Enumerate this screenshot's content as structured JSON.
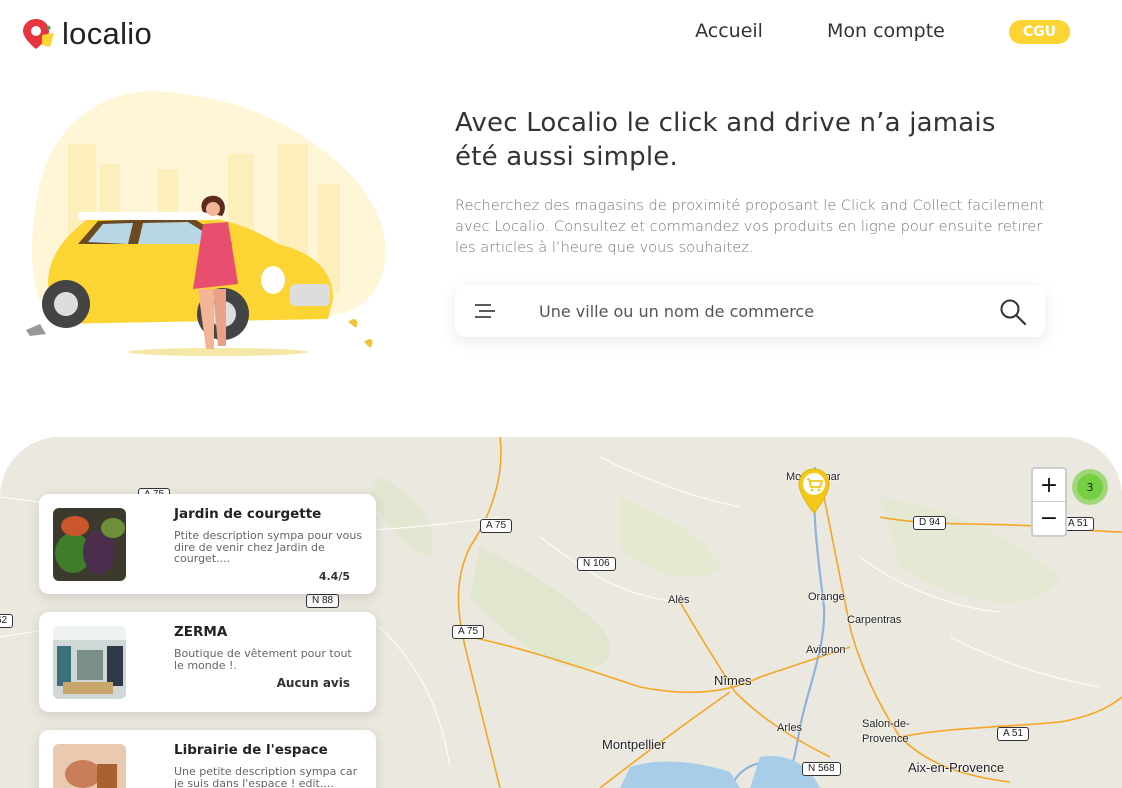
{
  "header": {
    "logo_text": "localio",
    "nav": [
      "Accueil",
      "Mon compte",
      "CGU"
    ]
  },
  "hero": {
    "title_line1": "Avec Localio le click and drive n’a jamais",
    "title_line2": "été aussi simple.",
    "description": "Recherchez des magasins de proximité proposant le Click and Collect facilement avec Localio. Consultez et commandez vos produits en ligne pour ensuite retirer les articles à l’heure que vous souhaitez.",
    "search_placeholder": "Une ville ou un nom de commerce"
  },
  "map": {
    "zoom_in": "+",
    "zoom_out": "−",
    "cluster_count": "3",
    "road_labels": [
      "A 75",
      "A 75",
      "N 106",
      "N 88",
      "D 94",
      "A 51",
      "A 51",
      "N 568",
      "62"
    ],
    "cities": [
      "Montélimar",
      "Alès",
      "Orange",
      "Carpentras",
      "Avignon",
      "Nîmes",
      "Arles",
      "Salon-de-Provence",
      "Montpellier",
      "Aix-en-Provence"
    ]
  },
  "shops": [
    {
      "name": "Jardin de courgette",
      "description": "Ptite description sympa pour vous dire de venir chez Jardin de courget....",
      "rating": "4.4/5"
    },
    {
      "name": "ZERMA",
      "description": "Boutique de vêtement pour tout le monde !.",
      "rating": "Aucun avis"
    },
    {
      "name": "Librairie de l'espace",
      "description": "Une petite description sympa car je suis dans l'espace ! edit....",
      "rating": ""
    }
  ],
  "colors": {
    "accent_yellow": "#fcd534",
    "logo_red": "#e8343f",
    "cluster_green": "#6ecc39"
  }
}
